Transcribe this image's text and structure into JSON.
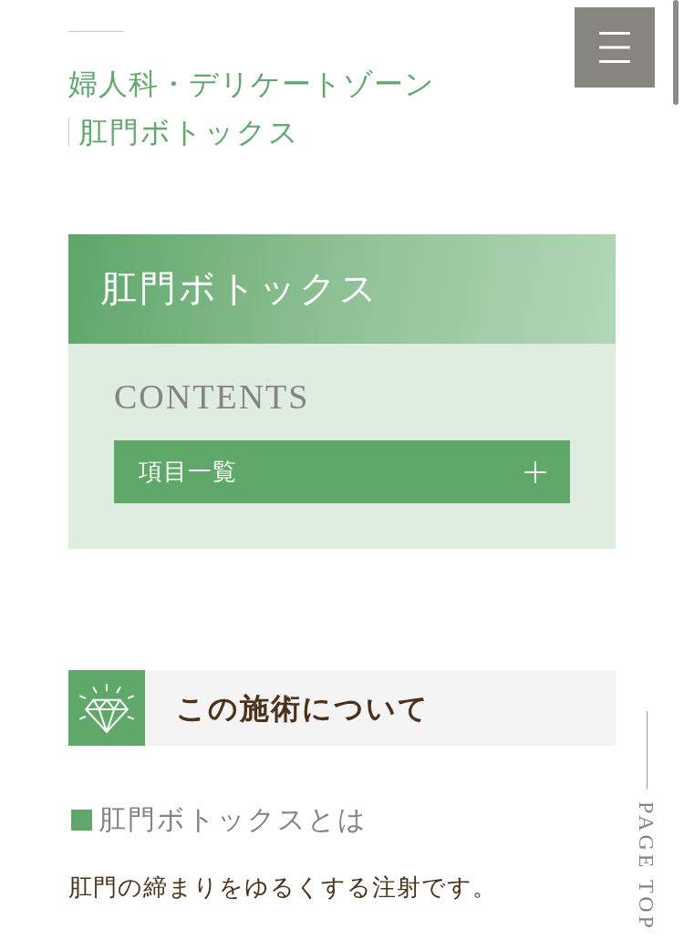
{
  "breadcrumb": {
    "category": "婦人科・デリケートゾーン",
    "current": "肛門ボトックス"
  },
  "page_header": {
    "title": "肛門ボトックス"
  },
  "contents": {
    "heading": "CONTENTS",
    "toggle": {
      "label": "項目一覧",
      "expanded": false
    }
  },
  "section": {
    "heading": "この施術について",
    "subheading": "肛門ボトックスとは",
    "body": "肛門の締まりをゆるくする注射です。"
  },
  "page_top": {
    "label": "PAGE TOP"
  }
}
